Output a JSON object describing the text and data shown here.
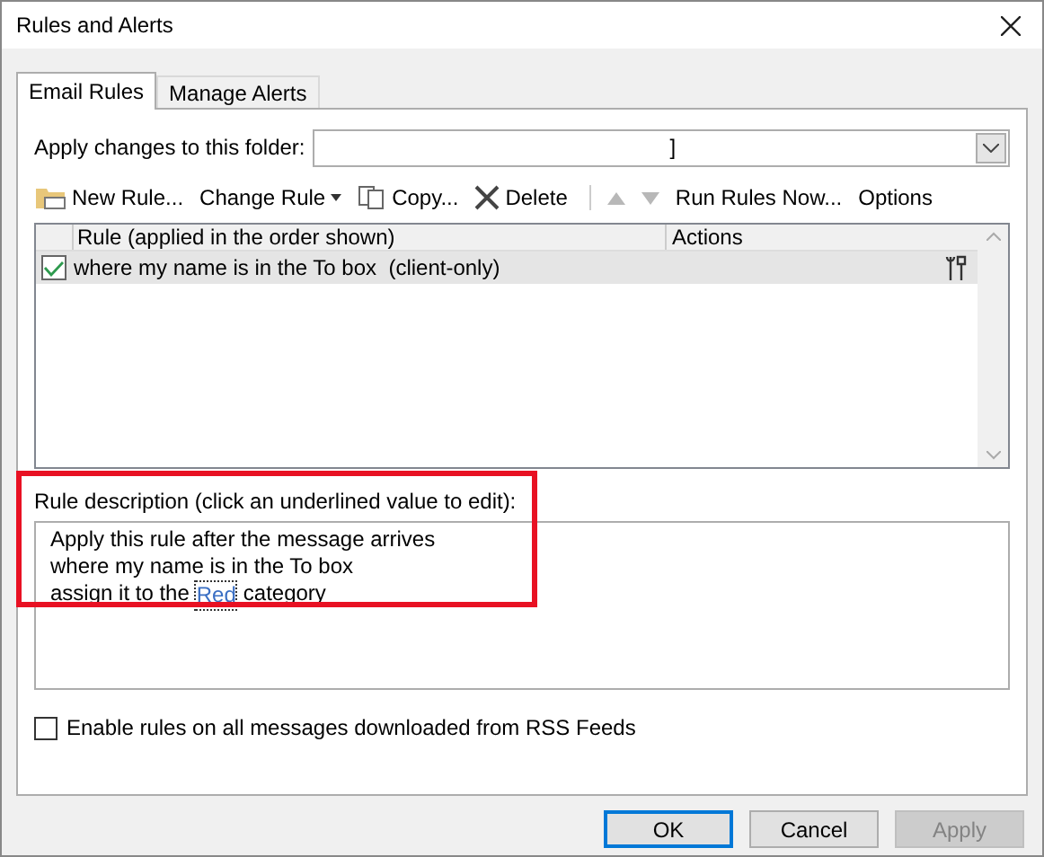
{
  "window": {
    "title": "Rules and Alerts"
  },
  "tabs": [
    {
      "label": "Email Rules",
      "selected": true
    },
    {
      "label": "Manage Alerts",
      "selected": false
    }
  ],
  "folder": {
    "label": "Apply changes to this folder:",
    "value": "]"
  },
  "toolbar": [
    {
      "kind": "new",
      "label": "New Rule...",
      "disabled": false
    },
    {
      "kind": "dropdown",
      "label": "Change Rule",
      "disabled": false
    },
    {
      "kind": "copy",
      "label": "Copy...",
      "disabled": false
    },
    {
      "kind": "delete",
      "label": "Delete",
      "disabled": false
    },
    {
      "kind": "up",
      "disabled": true
    },
    {
      "kind": "down",
      "disabled": true
    },
    {
      "kind": "plain",
      "label": "Run Rules Now...",
      "disabled": false
    },
    {
      "kind": "plain",
      "label": "Options",
      "disabled": false
    }
  ],
  "table": {
    "columns": [
      "Rule (applied in the order shown)",
      "Actions"
    ],
    "rows": [
      {
        "rule": "where my name is in the To box  (client-only)",
        "checked": true,
        "selected": true
      }
    ]
  },
  "description": {
    "label": "Rule description (click an underlined value to edit):",
    "highlighted": true,
    "lines": [
      [
        {
          "kind": "text",
          "text": "Apply this rule after the message arrives"
        }
      ],
      [
        {
          "kind": "text",
          "text": "where my name is in the To box"
        }
      ],
      [
        {
          "kind": "text",
          "text": "assign it to the"
        },
        {
          "kind": "link",
          "text": "Red"
        },
        {
          "kind": "text",
          "text": "category"
        }
      ]
    ]
  },
  "rss": {
    "label": "Enable rules on all messages downloaded from RSS Feeds",
    "checked": false
  },
  "buttons": [
    {
      "label": "OK",
      "default": true,
      "disabled": false
    },
    {
      "label": "Cancel",
      "default": false,
      "disabled": false
    },
    {
      "label": "Apply",
      "default": false,
      "disabled": true
    }
  ]
}
